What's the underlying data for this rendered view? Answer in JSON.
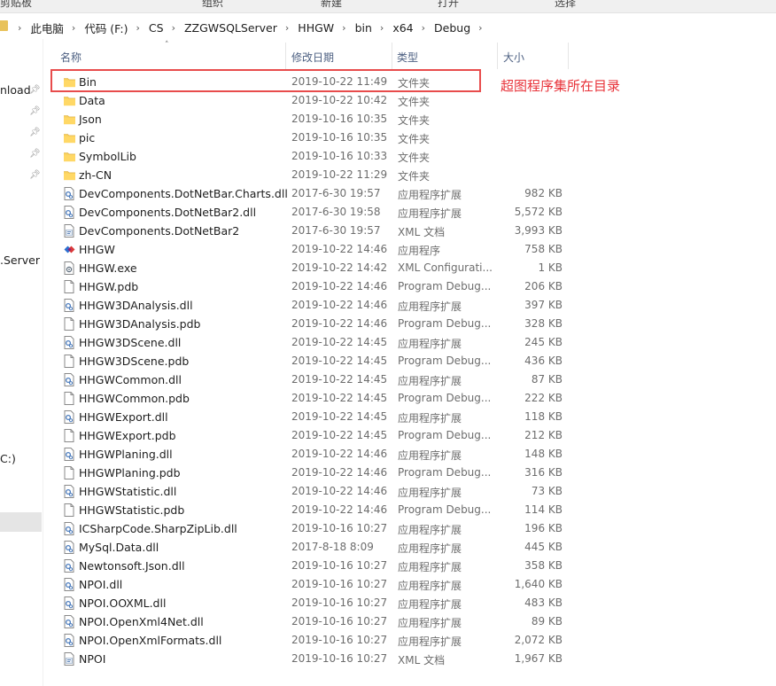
{
  "ribbon": {
    "groups": [
      "剪贴板",
      "组织",
      "新建",
      "打开",
      "选择"
    ]
  },
  "address": {
    "crumbs": [
      "此电脑",
      "代码 (F:)",
      "CS",
      "ZZGWSQLServer",
      "HHGW",
      "bin",
      "x64",
      "Debug"
    ]
  },
  "nav": {
    "items": [
      "nload",
      "",
      "",
      "",
      "",
      ".Server",
      "C:)"
    ]
  },
  "columns": {
    "name": "名称",
    "date": "修改日期",
    "type": "类型",
    "size": "大小"
  },
  "annotation": "超图程序集所在目录",
  "files": [
    {
      "name": "Bin",
      "date": "2019-10-22 11:49",
      "type": "文件夹",
      "size": "",
      "icon": "folder-icon"
    },
    {
      "name": "Data",
      "date": "2019-10-22 10:42",
      "type": "文件夹",
      "size": "",
      "icon": "folder-icon"
    },
    {
      "name": "Json",
      "date": "2019-10-16 10:35",
      "type": "文件夹",
      "size": "",
      "icon": "folder-icon"
    },
    {
      "name": "pic",
      "date": "2019-10-16 10:35",
      "type": "文件夹",
      "size": "",
      "icon": "folder-icon"
    },
    {
      "name": "SymbolLib",
      "date": "2019-10-16 10:33",
      "type": "文件夹",
      "size": "",
      "icon": "folder-icon"
    },
    {
      "name": "zh-CN",
      "date": "2019-10-22 11:29",
      "type": "文件夹",
      "size": "",
      "icon": "folder-icon"
    },
    {
      "name": "DevComponents.DotNetBar.Charts.dll",
      "date": "2017-6-30 19:57",
      "type": "应用程序扩展",
      "size": "982 KB",
      "icon": "dll-icon"
    },
    {
      "name": "DevComponents.DotNetBar2.dll",
      "date": "2017-6-30 19:58",
      "type": "应用程序扩展",
      "size": "5,572 KB",
      "icon": "dll-icon"
    },
    {
      "name": "DevComponents.DotNetBar2",
      "date": "2017-6-30 19:57",
      "type": "XML 文档",
      "size": "3,993 KB",
      "icon": "xml-icon"
    },
    {
      "name": "HHGW",
      "date": "2019-10-22 14:46",
      "type": "应用程序",
      "size": "758 KB",
      "icon": "app-icon"
    },
    {
      "name": "HHGW.exe",
      "date": "2019-10-22 14:42",
      "type": "XML Configurati...",
      "size": "1 KB",
      "icon": "config-icon"
    },
    {
      "name": "HHGW.pdb",
      "date": "2019-10-22 14:46",
      "type": "Program Debug...",
      "size": "206 KB",
      "icon": "file-icon"
    },
    {
      "name": "HHGW3DAnalysis.dll",
      "date": "2019-10-22 14:46",
      "type": "应用程序扩展",
      "size": "397 KB",
      "icon": "dll-icon"
    },
    {
      "name": "HHGW3DAnalysis.pdb",
      "date": "2019-10-22 14:46",
      "type": "Program Debug...",
      "size": "328 KB",
      "icon": "file-icon"
    },
    {
      "name": "HHGW3DScene.dll",
      "date": "2019-10-22 14:45",
      "type": "应用程序扩展",
      "size": "245 KB",
      "icon": "dll-icon"
    },
    {
      "name": "HHGW3DScene.pdb",
      "date": "2019-10-22 14:45",
      "type": "Program Debug...",
      "size": "436 KB",
      "icon": "file-icon"
    },
    {
      "name": "HHGWCommon.dll",
      "date": "2019-10-22 14:45",
      "type": "应用程序扩展",
      "size": "87 KB",
      "icon": "dll-icon"
    },
    {
      "name": "HHGWCommon.pdb",
      "date": "2019-10-22 14:45",
      "type": "Program Debug...",
      "size": "222 KB",
      "icon": "file-icon"
    },
    {
      "name": "HHGWExport.dll",
      "date": "2019-10-22 14:45",
      "type": "应用程序扩展",
      "size": "118 KB",
      "icon": "dll-icon"
    },
    {
      "name": "HHGWExport.pdb",
      "date": "2019-10-22 14:45",
      "type": "Program Debug...",
      "size": "212 KB",
      "icon": "file-icon"
    },
    {
      "name": "HHGWPlaning.dll",
      "date": "2019-10-22 14:46",
      "type": "应用程序扩展",
      "size": "148 KB",
      "icon": "dll-icon"
    },
    {
      "name": "HHGWPlaning.pdb",
      "date": "2019-10-22 14:46",
      "type": "Program Debug...",
      "size": "316 KB",
      "icon": "file-icon"
    },
    {
      "name": "HHGWStatistic.dll",
      "date": "2019-10-22 14:46",
      "type": "应用程序扩展",
      "size": "73 KB",
      "icon": "dll-icon"
    },
    {
      "name": "HHGWStatistic.pdb",
      "date": "2019-10-22 14:46",
      "type": "Program Debug...",
      "size": "114 KB",
      "icon": "file-icon"
    },
    {
      "name": "ICSharpCode.SharpZipLib.dll",
      "date": "2019-10-16 10:27",
      "type": "应用程序扩展",
      "size": "196 KB",
      "icon": "dll-icon"
    },
    {
      "name": "MySql.Data.dll",
      "date": "2017-8-18 8:09",
      "type": "应用程序扩展",
      "size": "445 KB",
      "icon": "dll-icon"
    },
    {
      "name": "Newtonsoft.Json.dll",
      "date": "2019-10-16 10:27",
      "type": "应用程序扩展",
      "size": "358 KB",
      "icon": "dll-icon"
    },
    {
      "name": "NPOI.dll",
      "date": "2019-10-16 10:27",
      "type": "应用程序扩展",
      "size": "1,640 KB",
      "icon": "dll-icon"
    },
    {
      "name": "NPOI.OOXML.dll",
      "date": "2019-10-16 10:27",
      "type": "应用程序扩展",
      "size": "483 KB",
      "icon": "dll-icon"
    },
    {
      "name": "NPOI.OpenXml4Net.dll",
      "date": "2019-10-16 10:27",
      "type": "应用程序扩展",
      "size": "89 KB",
      "icon": "dll-icon"
    },
    {
      "name": "NPOI.OpenXmlFormats.dll",
      "date": "2019-10-16 10:27",
      "type": "应用程序扩展",
      "size": "2,072 KB",
      "icon": "dll-icon"
    },
    {
      "name": "NPOI",
      "date": "2019-10-16 10:27",
      "type": "XML 文档",
      "size": "1,967 KB",
      "icon": "xml-icon"
    }
  ]
}
